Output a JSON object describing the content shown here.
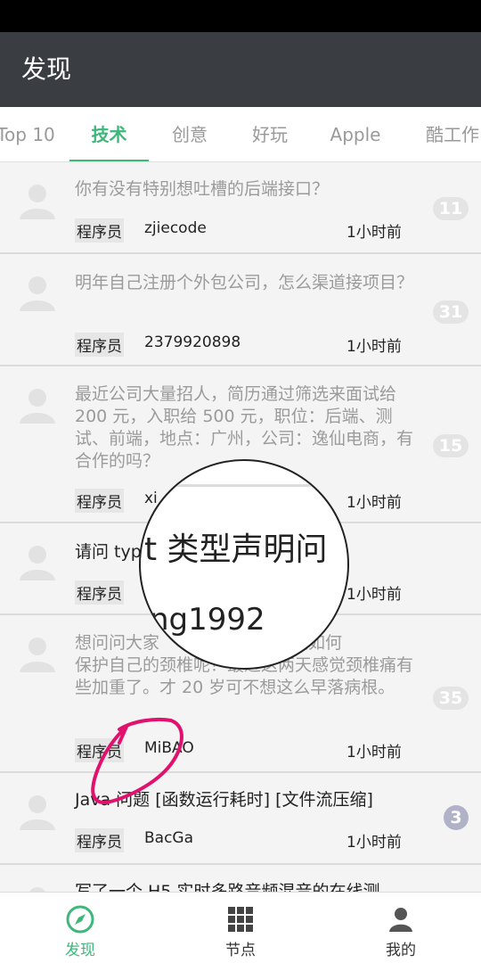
{
  "appbar": {
    "title": "发现"
  },
  "tabs": [
    {
      "label": "Top 10"
    },
    {
      "label": "技术"
    },
    {
      "label": "创意"
    },
    {
      "label": "好玩"
    },
    {
      "label": "Apple"
    },
    {
      "label": "酷工作"
    }
  ],
  "topics": [
    {
      "title": "你有没有特别想吐槽的后端接口？",
      "node": "程序员",
      "author": "zjiecode",
      "time": "1小时前",
      "replies": "11"
    },
    {
      "title": "明年自己注册个外包公司，怎么渠道接项目？",
      "node": "程序员",
      "author": "2379920898",
      "time": "1小时前",
      "replies": "31"
    },
    {
      "title": "最近公司大量招人，简历通过筛选来面试给 200 元，入职给 500 元，职位：后端、测试、前端，地点：广州，公司：逸仙电商，有合作的吗？",
      "node": "程序员",
      "author": "xi",
      "time": "1小时前",
      "replies": "15"
    },
    {
      "title": "请问 typ",
      "node": "程序员",
      "author": "",
      "time": "1小时前",
      "replies": ""
    },
    {
      "title": "想问问大家",
      "title2": "平时是如何",
      "title_rest": "保护自己的颈椎呢？最近这两天感觉颈椎痛有些加重了。才 20 岁可不想这么早落病根。",
      "node": "程序员",
      "author": "MiBAO",
      "time": "1小时前",
      "replies": "35"
    },
    {
      "title": "Java 问题 [函数运行耗时] [文件流压缩]",
      "node": "程序员",
      "author": "BacGa",
      "time": "1小时前",
      "replies": "3"
    },
    {
      "title": "写了一个 H5 实时多路音频混音的在线测",
      "node": "",
      "author": "",
      "time": "",
      "replies": ""
    }
  ],
  "magnifier": {
    "line1": "t 类型声明问",
    "line2": "ng1992"
  },
  "bottomnav": [
    {
      "label": "发现",
      "icon": "compass-icon"
    },
    {
      "label": "节点",
      "icon": "grid-icon"
    },
    {
      "label": "我的",
      "icon": "person-icon"
    }
  ],
  "colors": {
    "accent": "#3db77a",
    "appbar": "#3a3d42",
    "annotation": "#e0126e"
  }
}
